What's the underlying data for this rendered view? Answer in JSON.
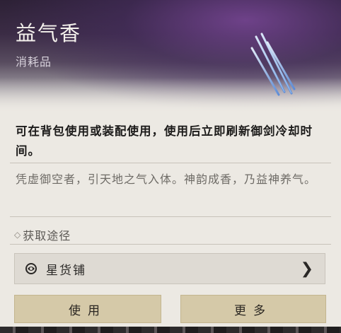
{
  "item": {
    "name": "益气香",
    "category": "消耗品",
    "icon": "incense-sticks-icon"
  },
  "description": {
    "main": "可在背包使用或装配使用，使用后立即刷新御剑冷却时间。",
    "lore": "凭虚御空者，引天地之气入体。神韵成香，乃益神养气。"
  },
  "acquisition": {
    "title": "获取途径",
    "sources": [
      {
        "label": "星货铺",
        "icon": "shop-icon"
      }
    ]
  },
  "actions": {
    "use_label": "使用",
    "more_label": "更多"
  },
  "colors": {
    "header_purple": "#3b2c45",
    "panel_bg": "#ece9e3",
    "button_bg": "#d5c9a8",
    "incense_glow": "#8fc8ff"
  }
}
